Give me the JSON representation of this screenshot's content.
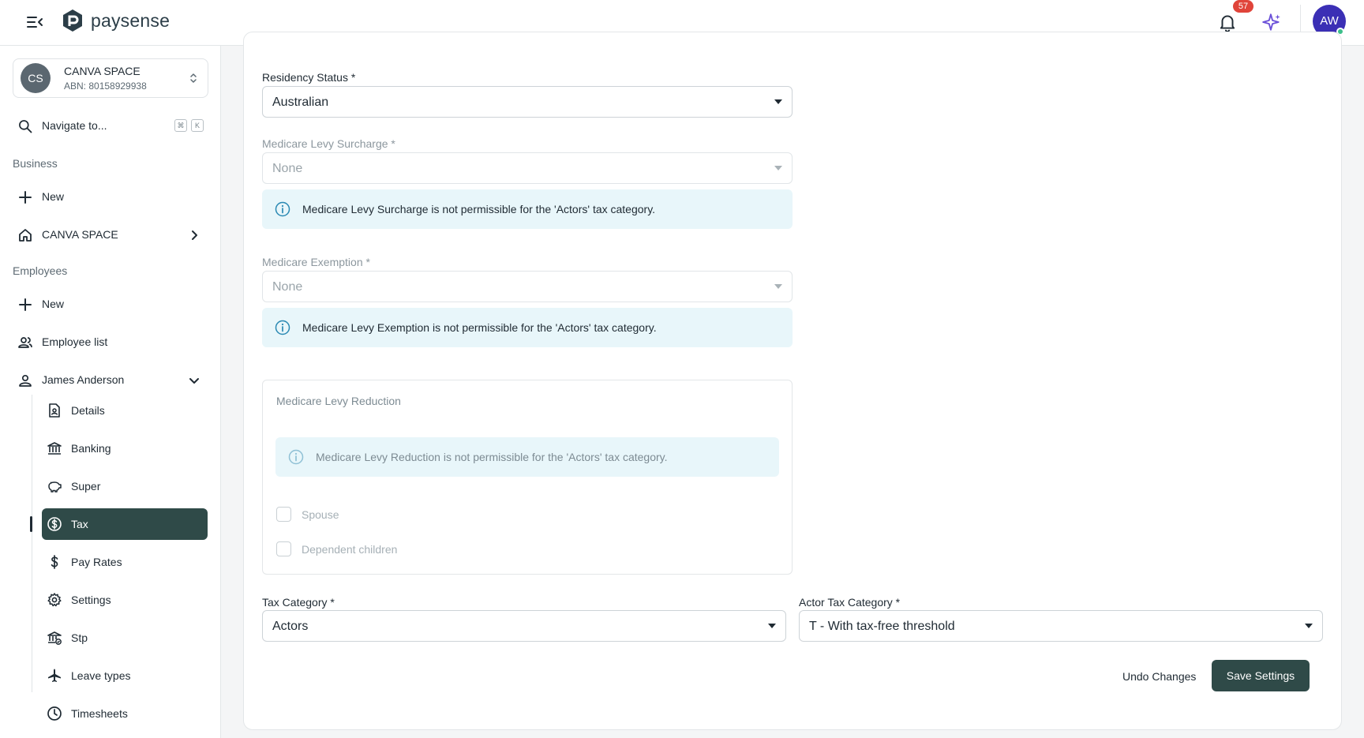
{
  "app": {
    "brand": "paysense",
    "notifications_count": "57",
    "user_initials": "AW",
    "accent_color": "#2f4a48"
  },
  "sidebar": {
    "org": {
      "initials": "CS",
      "name": "CANVA SPACE",
      "abn": "ABN: 80158929938"
    },
    "search": {
      "label": "Navigate to...",
      "shortcut_1": "⌘",
      "shortcut_2": "K"
    },
    "business_section": "Business",
    "business_new": "New",
    "business_org": "CANVA SPACE",
    "employees_section": "Employees",
    "employees_new": "New",
    "employee_list": "Employee list",
    "employee_name": "James Anderson",
    "sub_items": [
      {
        "label": "Details",
        "icon": "document-person-icon"
      },
      {
        "label": "Banking",
        "icon": "bank-icon"
      },
      {
        "label": "Super",
        "icon": "piggy-bank-icon"
      },
      {
        "label": "Tax",
        "icon": "dollar-circle-icon",
        "active": true
      },
      {
        "label": "Pay Rates",
        "icon": "dollar-icon"
      },
      {
        "label": "Settings",
        "icon": "gear-icon"
      },
      {
        "label": "Stp",
        "icon": "bank-check-icon"
      },
      {
        "label": "Leave types",
        "icon": "airplane-icon"
      },
      {
        "label": "Timesheets",
        "icon": "clock-icon"
      }
    ]
  },
  "form": {
    "residency_label": "Residency Status *",
    "residency_value": "Australian",
    "surcharge_label": "Medicare Levy Surcharge *",
    "surcharge_value": "None",
    "surcharge_alert": "Medicare Levy Surcharge is not permissible for the 'Actors' tax category.",
    "exemption_label": "Medicare Exemption *",
    "exemption_value": "None",
    "exemption_alert": "Medicare Levy Exemption is not permissible for the 'Actors' tax category.",
    "reduction_title": "Medicare Levy Reduction",
    "reduction_alert": "Medicare Levy Reduction is not permissible for the 'Actors' tax category.",
    "spouse_label": "Spouse",
    "dependents_label": "Dependent children",
    "tax_category_label": "Tax Category *",
    "tax_category_value": "Actors",
    "actor_tax_label": "Actor Tax Category *",
    "actor_tax_value": "T - With tax-free threshold",
    "undo_label": "Undo Changes",
    "save_label": "Save Settings"
  }
}
